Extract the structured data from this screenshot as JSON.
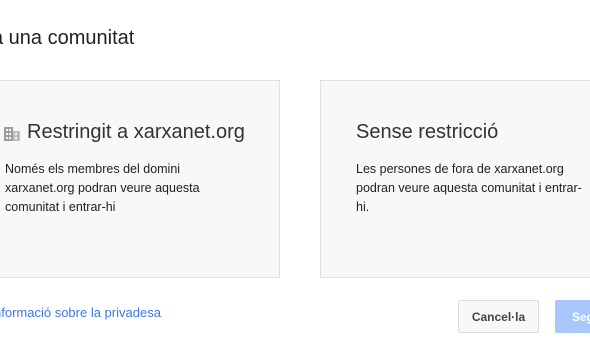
{
  "dialog": {
    "title": "a una comunitat"
  },
  "options": [
    {
      "heading": "Restringit a xarxanet.org",
      "icon": "building-icon",
      "description": "Només els membres del domini xarxanet.org podran veure aquesta comunitat i entrar-hi"
    },
    {
      "heading": "Sense restricció",
      "description": "Les persones de fora de xarxanet.org podran veure aquesta comunitat i entrar-hi."
    }
  ],
  "footer": {
    "privacy_link": "nformació sobre la privadesa",
    "cancel_label": "Cancel·la",
    "next_label": "Seg"
  },
  "colors": {
    "link": "#3b78e7",
    "next_button_disabled": "#a8c7fa",
    "card_background": "#f8f8f8"
  }
}
